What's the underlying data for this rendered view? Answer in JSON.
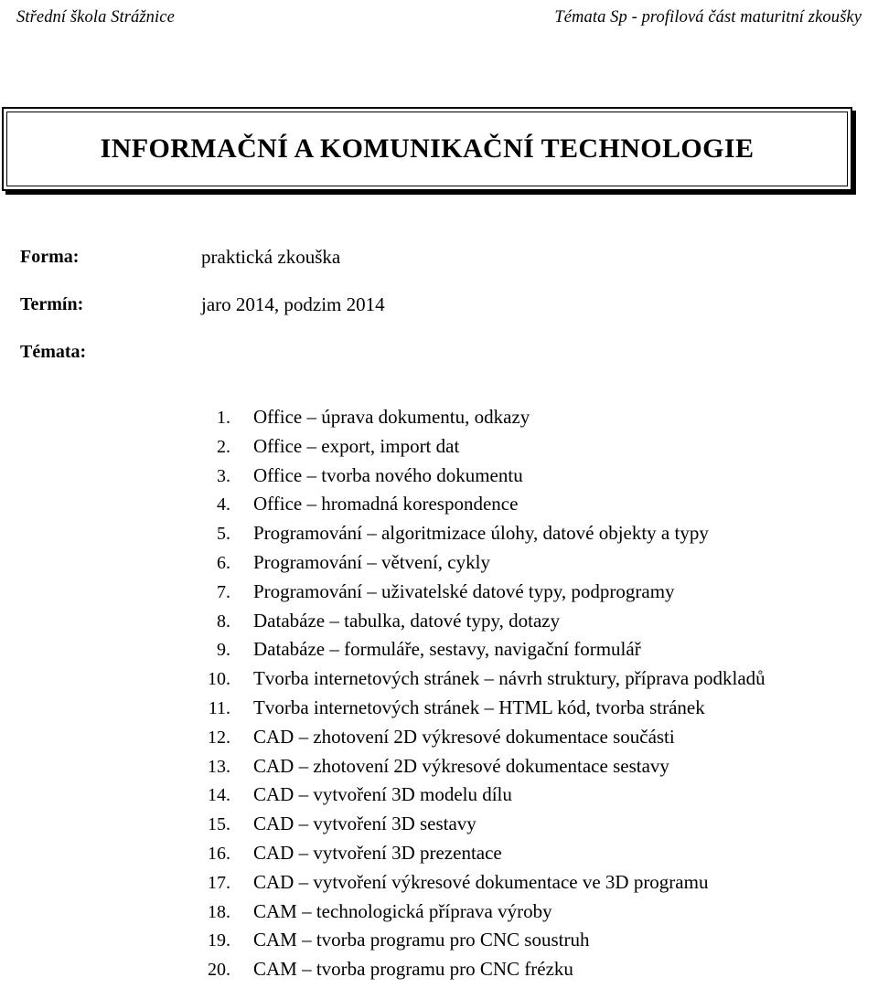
{
  "header": {
    "left": "Střední škola Strážnice",
    "right": "Témata Sp - profilová část maturitní zkoušky"
  },
  "title_box": {
    "title": "INFORMAČNÍ A KOMUNIKAČNÍ TECHNOLOGIE"
  },
  "meta": {
    "forma_label": "Forma:",
    "forma_value": "praktická zkouška",
    "termin_label": "Termín:",
    "termin_value": "jaro 2014, podzim 2014",
    "temata_label": "Témata:"
  },
  "topics": [
    {
      "num": "1.",
      "label": "Office – úprava dokumentu, odkazy"
    },
    {
      "num": "2.",
      "label": "Office – export, import dat"
    },
    {
      "num": "3.",
      "label": "Office – tvorba nového dokumentu"
    },
    {
      "num": "4.",
      "label": "Office – hromadná korespondence"
    },
    {
      "num": "5.",
      "label": "Programování – algoritmizace úlohy, datové objekty a typy"
    },
    {
      "num": "6.",
      "label": "Programování – větvení, cykly"
    },
    {
      "num": "7.",
      "label": "Programování – uživatelské datové typy, podprogramy"
    },
    {
      "num": "8.",
      "label": "Databáze – tabulka, datové typy, dotazy"
    },
    {
      "num": "9.",
      "label": "Databáze – formuláře, sestavy, navigační formulář"
    },
    {
      "num": "10.",
      "label": "Tvorba internetových stránek – návrh struktury, příprava podkladů"
    },
    {
      "num": "11.",
      "label": "Tvorba internetových stránek – HTML kód, tvorba stránek"
    },
    {
      "num": "12.",
      "label": "CAD – zhotovení 2D výkresové dokumentace součásti"
    },
    {
      "num": "13.",
      "label": "CAD – zhotovení 2D výkresové dokumentace sestavy"
    },
    {
      "num": "14.",
      "label": "CAD – vytvoření 3D modelu dílu"
    },
    {
      "num": "15.",
      "label": "CAD – vytvoření 3D sestavy"
    },
    {
      "num": "16.",
      "label": "CAD – vytvoření 3D prezentace"
    },
    {
      "num": "17.",
      "label": "CAD – vytvoření výkresové dokumentace ve 3D programu"
    },
    {
      "num": "18.",
      "label": "CAM – technologická příprava výroby"
    },
    {
      "num": "19.",
      "label": "CAM – tvorba programu pro CNC soustruh"
    },
    {
      "num": "20.",
      "label": "CAM – tvorba programu pro CNC frézku"
    }
  ],
  "colors": {
    "text": "#000000",
    "background": "#ffffff",
    "border": "#000000"
  }
}
